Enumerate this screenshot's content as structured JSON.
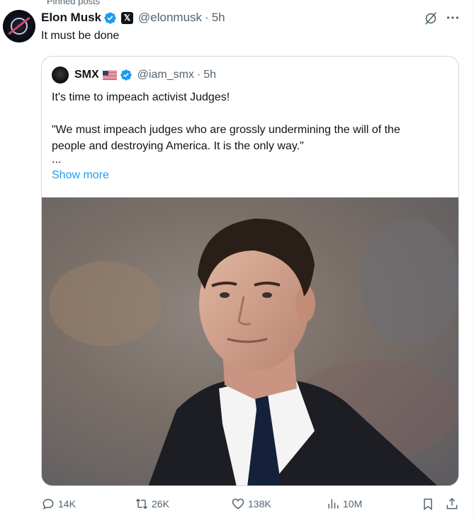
{
  "context": {
    "top_label": "Pinned posts"
  },
  "post": {
    "author_name": "Elon Musk",
    "handle": "@elonmusk",
    "separator": "·",
    "time": "5h",
    "text": "It must be done",
    "affiliation_badge": "𝕏"
  },
  "quote": {
    "author_name": "SMX",
    "handle": "@iam_smx",
    "separator": "·",
    "time": "5h",
    "line1": "It's time to impeach activist Judges!",
    "line2": "\"We must impeach judges who are grossly undermining the will of the",
    "line3": "people and destroying America. It is the only way.\"",
    "ellipsis": "...",
    "show_more": "Show more",
    "photo_icon": "photo-of-man-in-suit"
  },
  "stats": {
    "replies": "14K",
    "reposts": "26K",
    "likes": "138K",
    "views": "10M"
  },
  "colors": {
    "accent": "#1d9bf0",
    "text": "#0f1419",
    "muted": "#536471",
    "border": "#cfd9de"
  }
}
